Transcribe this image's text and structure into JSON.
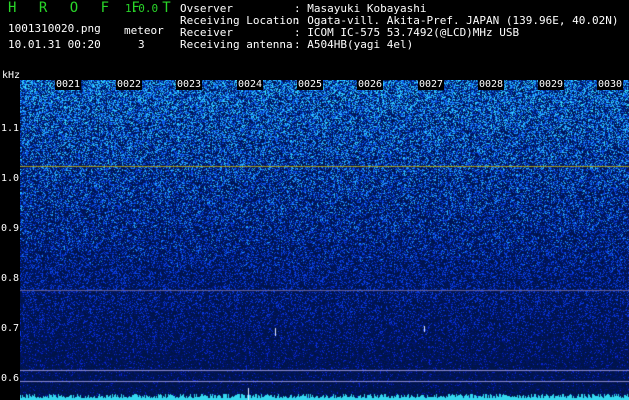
{
  "app": {
    "name": "H R O F F T",
    "version": "1.0.0"
  },
  "file": {
    "name": "1001310020.png",
    "datetime": "10.01.31 00:20"
  },
  "meteor": {
    "label": "meteor",
    "count": "3"
  },
  "info": [
    {
      "key": "Ovserver",
      "value": ": Masayuki Kobayashi"
    },
    {
      "key": "Receiving Location",
      "value": ": Ogata-vill. Akita-Pref. JAPAN (139.96E, 40.02N)"
    },
    {
      "key": "Receiver",
      "value": ": ICOM IC-575 53.7492(@LCD)MHz USB"
    },
    {
      "key": "Receiving antenna",
      "value": ": A504HB(yagi 4el)"
    }
  ],
  "axis": {
    "unit": "kHz",
    "y_ticks": [
      "1.1",
      "1.0",
      "0.9",
      "0.8",
      "0.7",
      "0.6"
    ],
    "x_ticks": [
      "0021",
      "0022",
      "0023",
      "0024",
      "0025",
      "0026",
      "0027",
      "0028",
      "0029",
      "0030"
    ]
  },
  "colors": {
    "title_green": "#29d629",
    "carrier_line": "#c8b400",
    "reference_line": "#8a8ad0"
  }
}
